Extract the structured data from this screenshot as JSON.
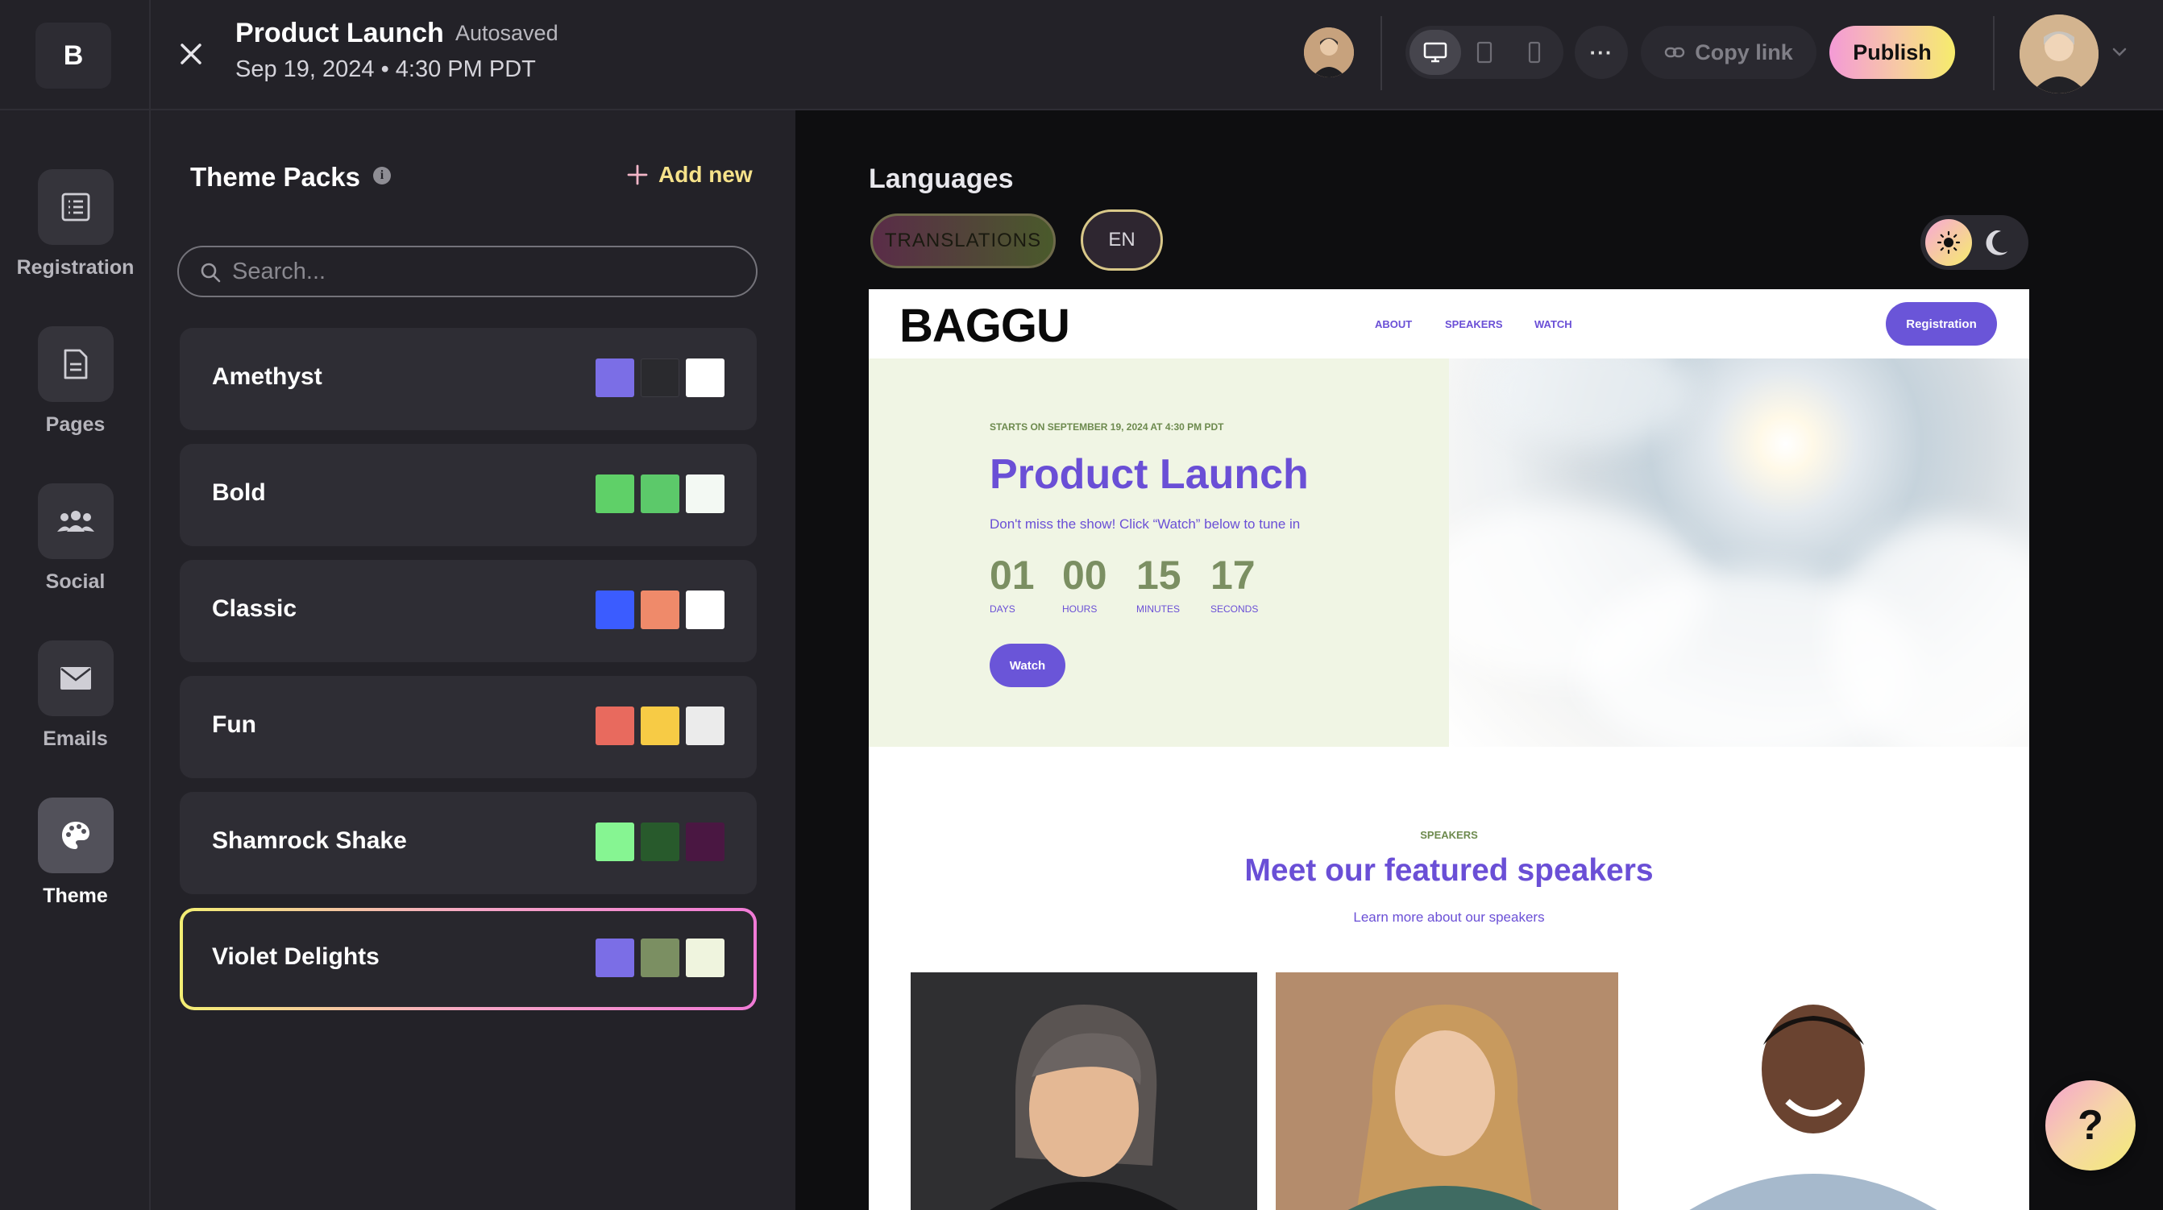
{
  "app": {
    "logo_letter": "B"
  },
  "header": {
    "title": "Product Launch",
    "autosaved": "Autosaved",
    "date": "Sep 19, 2024 • 4:30 PM PDT",
    "copy_link": "Copy link",
    "publish": "Publish",
    "more": "···"
  },
  "nav": {
    "items": [
      {
        "label": "Registration",
        "icon": "list-icon"
      },
      {
        "label": "Pages",
        "icon": "document-icon"
      },
      {
        "label": "Social",
        "icon": "people-icon"
      },
      {
        "label": "Emails",
        "icon": "envelope-icon"
      },
      {
        "label": "Theme",
        "icon": "palette-icon",
        "active": true
      }
    ]
  },
  "panel": {
    "title": "Theme Packs",
    "info": "i",
    "add_new": "Add new",
    "search_placeholder": "Search...",
    "themes": [
      {
        "name": "Amethyst",
        "colors": [
          "#7b6ee6",
          "#2a2a2e",
          "#ffffff"
        ]
      },
      {
        "name": "Bold",
        "colors": [
          "#5fd068",
          "#5cc96a",
          "#f3f9f3"
        ]
      },
      {
        "name": "Classic",
        "colors": [
          "#3b5cff",
          "#ef8a6a",
          "#ffffff"
        ]
      },
      {
        "name": "Fun",
        "colors": [
          "#e86a5e",
          "#f7cb45",
          "#ebebeb"
        ]
      },
      {
        "name": "Shamrock Shake",
        "colors": [
          "#86f592",
          "#285a2c",
          "#4a1742"
        ]
      },
      {
        "name": "Violet Delights",
        "colors": [
          "#7b6ee6",
          "#7b8f62",
          "#eff4de"
        ],
        "selected": true
      }
    ]
  },
  "preview": {
    "languages_title": "Languages",
    "translations": "TRANSLATIONS",
    "lang_code": "EN",
    "site": {
      "brand": "BAGGU",
      "nav_links": [
        "ABOUT",
        "SPEAKERS",
        "WATCH"
      ],
      "registration": "Registration",
      "starts": "STARTS ON SEPTEMBER 19, 2024 AT 4:30 PM PDT",
      "title": "Product Launch",
      "subtitle": "Don't miss the show! Click “Watch” below to tune in",
      "countdown": [
        {
          "value": "01",
          "label": "DAYS"
        },
        {
          "value": "00",
          "label": "HOURS"
        },
        {
          "value": "15",
          "label": "MINUTES"
        },
        {
          "value": "17",
          "label": "SECONDS"
        }
      ],
      "watch": "Watch",
      "speakers_eyebrow": "SPEAKERS",
      "speakers_title": "Meet our featured speakers",
      "speakers_link": "Learn more about our speakers"
    }
  },
  "help": {
    "label": "?"
  },
  "colors": {
    "accent": "#6a55d8",
    "olive": "#7b8f62",
    "hero_bg": "#f0f5e4"
  }
}
